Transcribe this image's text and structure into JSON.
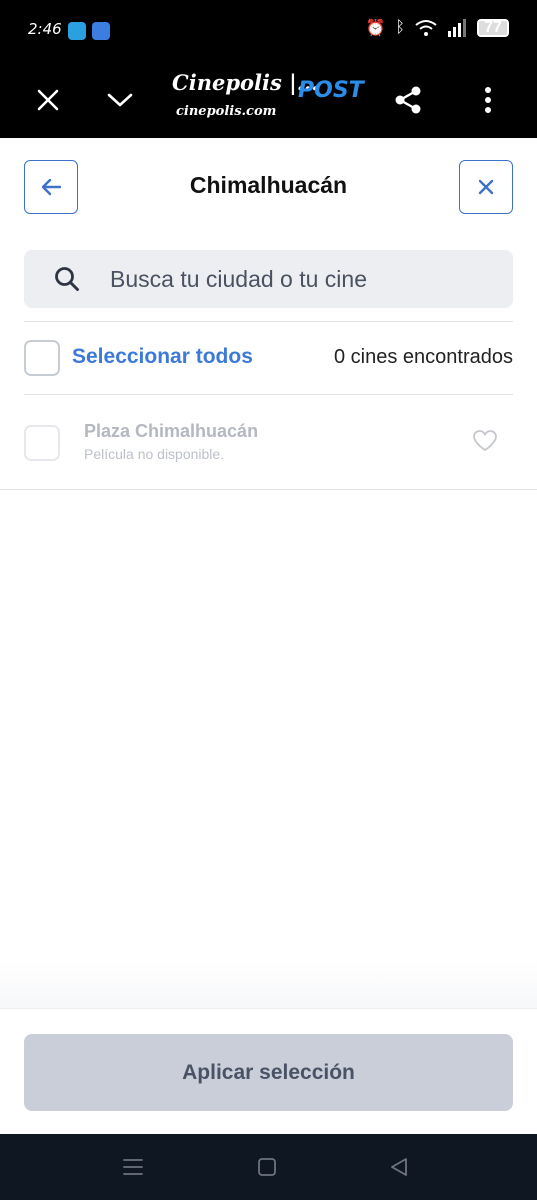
{
  "status_bar": {
    "time": "2:46",
    "battery": "77"
  },
  "browser": {
    "site_title": "Cinepolis |...",
    "site_domain": "cinepolis.com",
    "badge": "POST"
  },
  "header": {
    "title": "Chimalhuacán"
  },
  "search": {
    "placeholder": "Busca tu ciudad o tu cine"
  },
  "select_all": {
    "label": "Seleccionar todos",
    "count": "0 cines encontrados"
  },
  "cinemas": [
    {
      "name": "Plaza Chimalhuacán",
      "status": "Película no disponible."
    }
  ],
  "footer": {
    "apply_label": "Aplicar selección"
  },
  "colors": {
    "accent": "#3d7ad8",
    "disabled_button": "#c9ced8",
    "nav_bar": "#0f1722"
  }
}
